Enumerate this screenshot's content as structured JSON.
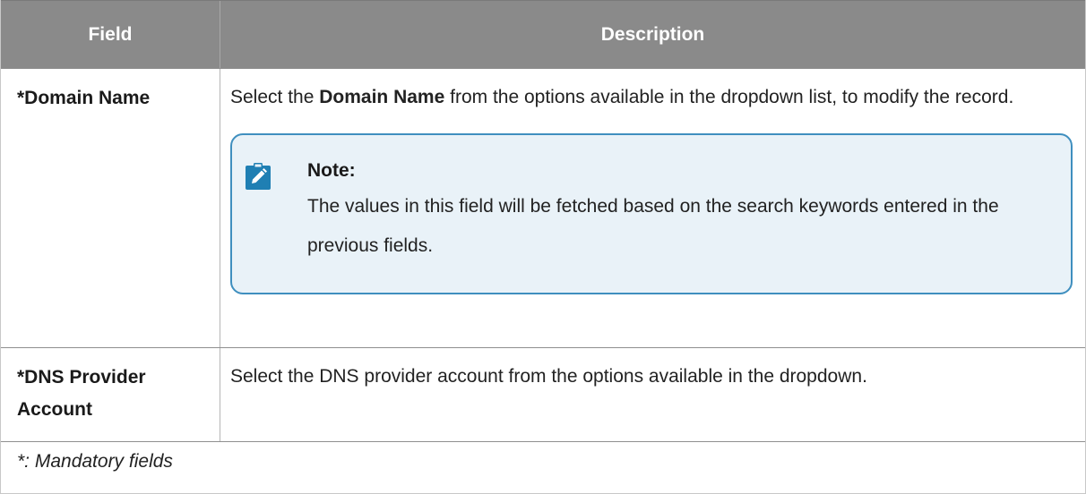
{
  "table": {
    "headers": {
      "field": "Field",
      "description": "Description"
    },
    "rows": [
      {
        "field": "*Domain Name",
        "desc_prefix": "Select the ",
        "desc_bold": "Domain Name",
        "desc_suffix": " from the options available in the dropdown list, to modify the record.",
        "note": {
          "icon": "note-pencil-icon",
          "title": "Note:",
          "text": "The values in this field will be fetched based on the search keywords entered in the previous fields."
        }
      },
      {
        "field": "*DNS Provider Account",
        "description": "Select the DNS provider account from the options available in the dropdown."
      }
    ],
    "footer": "*: Mandatory fields"
  },
  "colors": {
    "header_bg": "#8a8a8a",
    "note_border": "#3f8fbf",
    "note_bg": "#e9f2f8",
    "icon_color": "#1f7fb3"
  }
}
